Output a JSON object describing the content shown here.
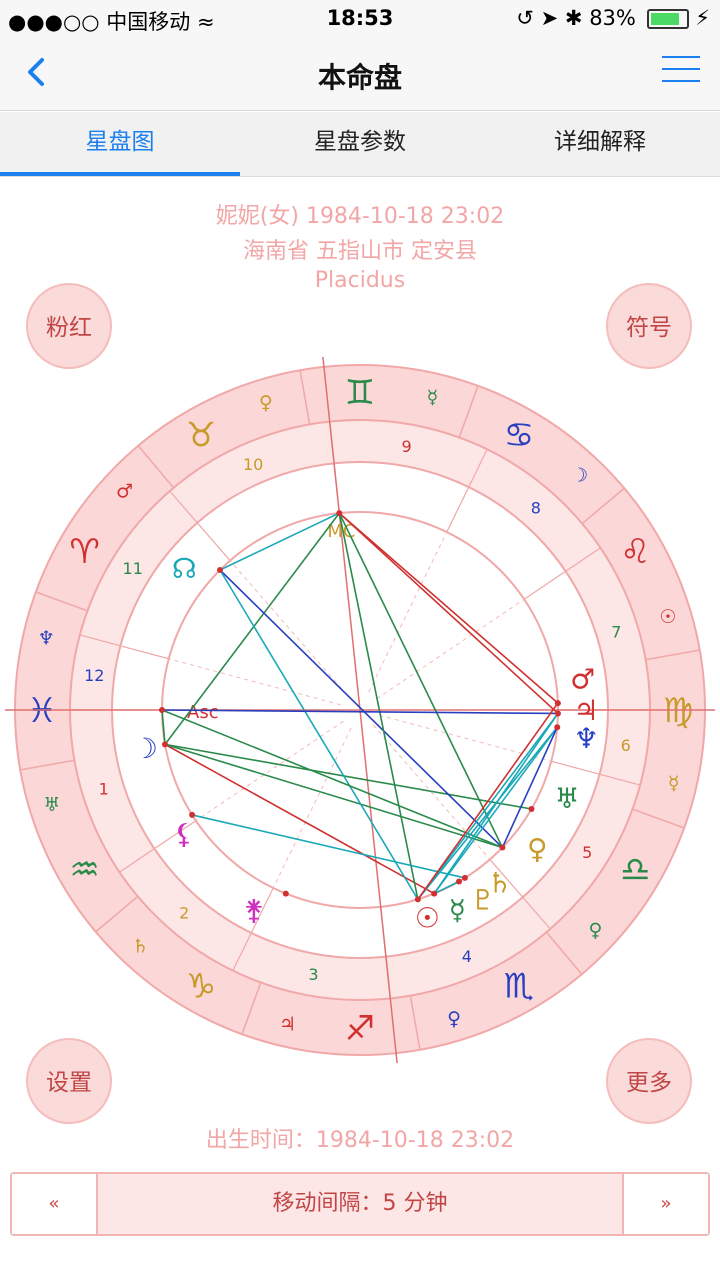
{
  "status_bar": {
    "carrier": "●●●○○ 中国移动 ",
    "time": "18:53",
    "battery": "83%",
    "battery_level": 0.83
  },
  "nav": {
    "title": "本命盘"
  },
  "tabs": [
    {
      "label": "星盘图",
      "active": true
    },
    {
      "label": "星盘参数"
    },
    {
      "label": "详细解释"
    }
  ],
  "chart_info": {
    "subject": "妮妮(女) 1984-10-18 23:02",
    "location": "海南省 五指山市 定安县",
    "house_system": "Placidus"
  },
  "corner_buttons": {
    "pink": "粉红",
    "symbols": "符号",
    "settings": "设置",
    "more": "更多"
  },
  "wheel": {
    "angle_labels": {
      "asc": "Asc",
      "mc": "MC"
    },
    "signs": [
      {
        "glyph": "♈",
        "ruler": "♂",
        "color": "#d03030"
      },
      {
        "glyph": "♉",
        "ruler": "♀",
        "color": "#c89a2a"
      },
      {
        "glyph": "♊",
        "ruler": "☿",
        "color": "#2a8a4a"
      },
      {
        "glyph": "♋",
        "ruler": "☽",
        "color": "#2840c0"
      },
      {
        "glyph": "♌",
        "ruler": "☉",
        "color": "#d03030"
      },
      {
        "glyph": "♍",
        "ruler": "☿",
        "color": "#c89a2a"
      },
      {
        "glyph": "♎",
        "ruler": "♀",
        "color": "#2a8a4a"
      },
      {
        "glyph": "♏",
        "ruler": "♀",
        "color": "#2840c0"
      },
      {
        "glyph": "♐",
        "ruler": "♃",
        "color": "#d03030"
      },
      {
        "glyph": "♑",
        "ruler": "♄",
        "color": "#c89a2a"
      },
      {
        "glyph": "♒",
        "ruler": "♅",
        "color": "#2a8a4a"
      },
      {
        "glyph": "♓",
        "ruler": "♆",
        "color": "#2840c0"
      }
    ],
    "house_numbers": [
      "1",
      "2",
      "3",
      "4",
      "5",
      "6",
      "7",
      "8",
      "9",
      "10",
      "11",
      "12"
    ],
    "planets": [
      {
        "glyph": "☽",
        "color": "#2840c0"
      },
      {
        "glyph": "☊",
        "color": "#1aa8b8"
      },
      {
        "glyph": "♂",
        "color": "#d03030"
      },
      {
        "glyph": "⚸",
        "color": "#d030c0"
      },
      {
        "glyph": "♃",
        "color": "#d03030"
      },
      {
        "glyph": "♆",
        "color": "#2840c0"
      },
      {
        "glyph": "♅",
        "color": "#2a8a4a"
      },
      {
        "glyph": "♀",
        "color": "#c89a2a"
      },
      {
        "glyph": "♄",
        "color": "#c89a2a"
      },
      {
        "glyph": "♇",
        "color": "#c89a2a"
      },
      {
        "glyph": "☿",
        "color": "#2a8a4a"
      },
      {
        "glyph": "☉",
        "color": "#d03030"
      },
      {
        "glyph": "⚵",
        "color": "#d030c0"
      }
    ]
  },
  "birth_time": "出生时间：1984-10-18 23:02",
  "stepper": {
    "prev": "«",
    "label": "移动间隔：5 分钟",
    "next": "»"
  }
}
